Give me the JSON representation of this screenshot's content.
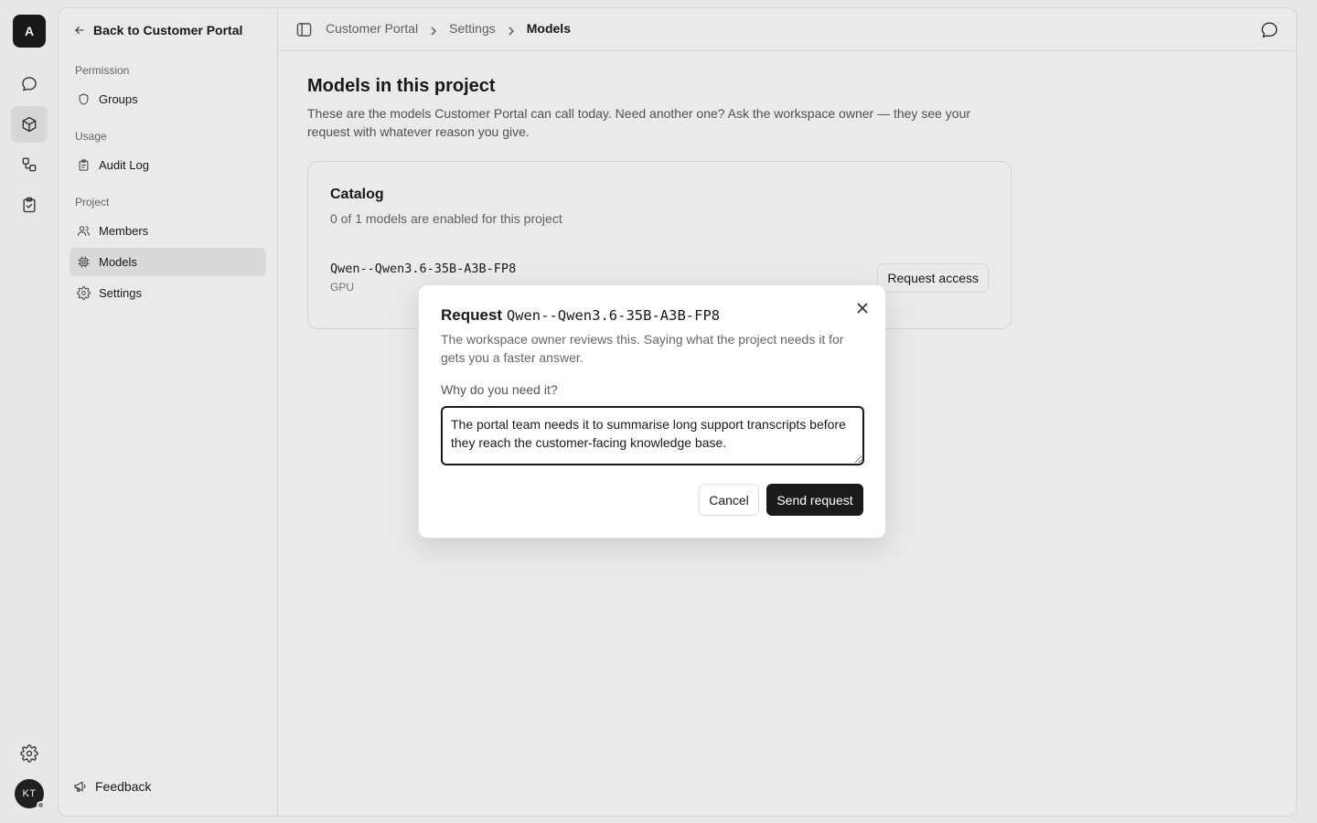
{
  "workspace": {
    "initial": "A"
  },
  "user": {
    "initials": "KT"
  },
  "sidebar": {
    "back_label": "Back to Customer Portal",
    "sections": [
      {
        "label": "Permission",
        "items": [
          {
            "label": "Groups",
            "icon": "shield-icon"
          }
        ]
      },
      {
        "label": "Usage",
        "items": [
          {
            "label": "Audit Log",
            "icon": "clipboard-icon"
          }
        ]
      },
      {
        "label": "Project",
        "items": [
          {
            "label": "Members",
            "icon": "users-icon"
          },
          {
            "label": "Models",
            "icon": "chip-icon",
            "active": true
          },
          {
            "label": "Settings",
            "icon": "gear-icon"
          }
        ]
      }
    ],
    "feedback_label": "Feedback"
  },
  "breadcrumb": [
    "Customer Portal",
    "Settings",
    "Models"
  ],
  "page": {
    "title": "Models in this project",
    "description": "These are the models Customer Portal can call today. Need another one? Ask the workspace owner — they see your request with whatever reason you give."
  },
  "catalog": {
    "title": "Catalog",
    "summary": "0 of 1 models are enabled for this project",
    "models": [
      {
        "name": "Qwen--Qwen3.6-35B-A3B-FP8",
        "tag": "GPU",
        "action": "Request access"
      }
    ]
  },
  "modal": {
    "title_prefix": "Request",
    "model": "Qwen--Qwen3.6-35B-A3B-FP8",
    "description": "The workspace owner reviews this. Saying what the project needs it for gets you a faster answer.",
    "field_label": "Why do you need it?",
    "reason": "The portal team needs it to summarise long support transcripts before they reach the customer-facing knowledge base.",
    "cancel_label": "Cancel",
    "submit_label": "Send request"
  },
  "colors": {
    "primary": "#1a1a1a",
    "background": "#f7f7f7",
    "active_nav": "#e5e5e5"
  }
}
